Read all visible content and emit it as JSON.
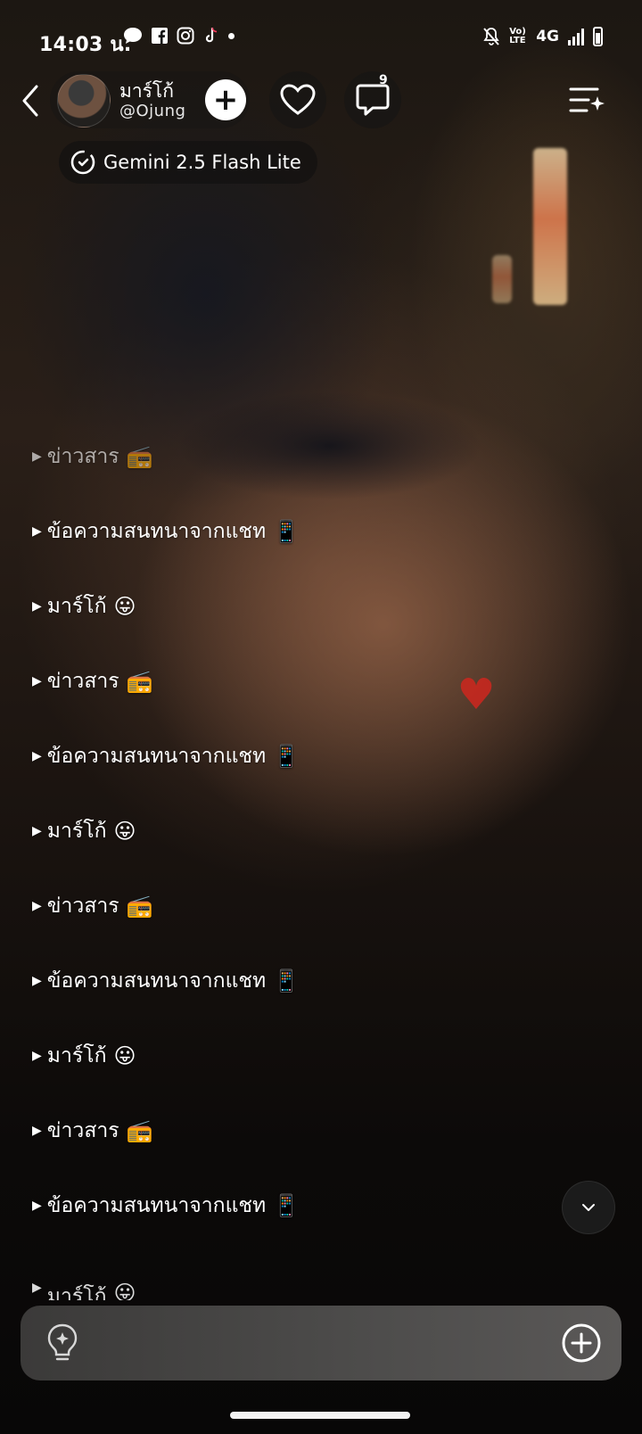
{
  "status_bar": {
    "time": "14:03 น.",
    "network": "4G",
    "volte": "Vo) LTE"
  },
  "header": {
    "character_name": "มาร์โก้",
    "character_handle": "@Ojung",
    "add_label": "+",
    "notification_count": "9",
    "model_name": "Gemini 2.5 Flash Lite"
  },
  "chat_items": [
    {
      "label": "ข่าวสาร",
      "emoji": "📻"
    },
    {
      "label": "ข้อความสนทนาจากแชท",
      "emoji": "📱"
    },
    {
      "label": "มาร์โก้",
      "emoji": "😛"
    },
    {
      "label": "ข่าวสาร",
      "emoji": "📻"
    },
    {
      "label": "ข้อความสนทนาจากแชท",
      "emoji": "📱"
    },
    {
      "label": "มาร์โก้",
      "emoji": "😛"
    },
    {
      "label": "ข่าวสาร",
      "emoji": "📻"
    },
    {
      "label": "ข้อความสนทนาจากแชท",
      "emoji": "📱"
    },
    {
      "label": "มาร์โก้",
      "emoji": "😛"
    },
    {
      "label": "ข่าวสาร",
      "emoji": "📻"
    },
    {
      "label": "ข้อความสนทนาจากแชท",
      "emoji": "📱"
    },
    {
      "label": "มาร์โก้",
      "emoji": "😛"
    }
  ],
  "icons": {
    "back": "back-arrow-icon",
    "heart": "heart-icon",
    "chat": "chat-bubble-icon",
    "menu": "menu-sparkle-icon",
    "model": "model-switch-icon",
    "scroll": "chevron-down-icon",
    "hint": "lightbulb-icon",
    "attach": "plus-circle-icon"
  },
  "colors": {
    "accent_heart": "#c8281f",
    "input_bar": "#4e4d4c"
  }
}
